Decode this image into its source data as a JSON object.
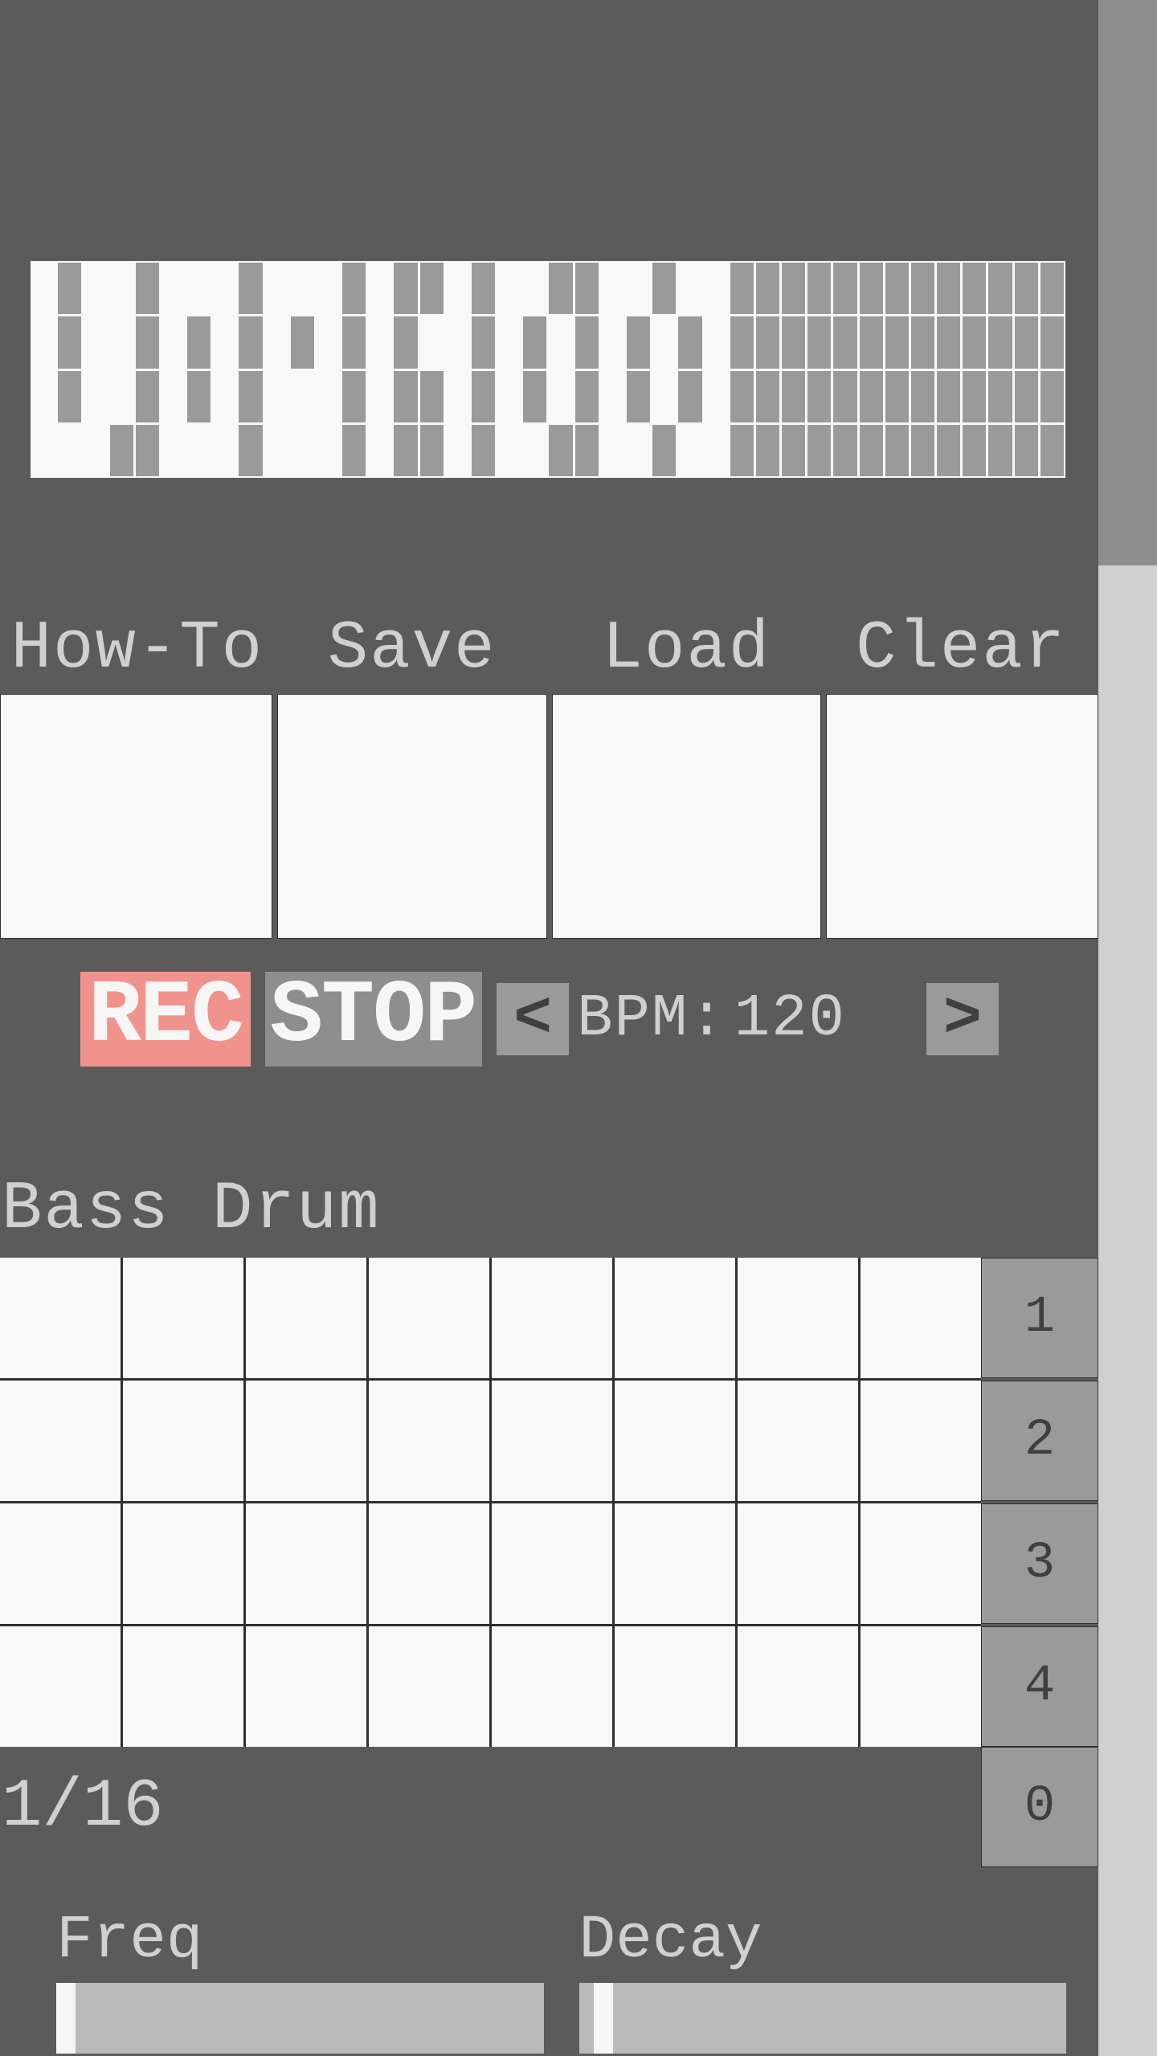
{
  "logo_pattern": [
    "1011011101110100101100110110",
    "1011010101010101101010101010",
    "1011010101110100101010101010",
    "1110011101110100101100110110"
  ],
  "logo_cols": 40,
  "menu": {
    "howto": "How-To",
    "save": "Save",
    "load": "Load",
    "clear": "Clear"
  },
  "transport": {
    "rec": "REC",
    "stop": "STOP",
    "bpm_label": "BPM:",
    "bpm_value": "120",
    "dec_icon": "<",
    "inc_icon": ">"
  },
  "instrument": {
    "name": "Bass Drum",
    "steps": 8,
    "rows": 4,
    "pages": [
      "1",
      "2",
      "3",
      "4"
    ],
    "page_zero": "0",
    "step_count": "1/16"
  },
  "params": {
    "freq": {
      "label": "Freq",
      "value": 0.0
    },
    "decay": {
      "label": "Decay",
      "value": 0.03
    }
  },
  "scrollbar": {
    "thumb_ratio": 0.275
  }
}
